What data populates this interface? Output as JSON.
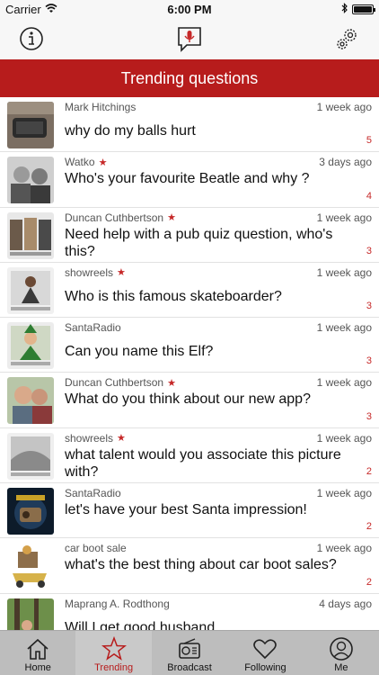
{
  "status_bar": {
    "carrier": "Carrier",
    "time": "6:00 PM",
    "battery_level": 1.0
  },
  "banner": {
    "title": "Trending questions"
  },
  "colors": {
    "brand_red": "#b71c1c",
    "count_red": "#c62828",
    "tab_bar": "#bdbdbd"
  },
  "questions": [
    {
      "author": "Mark Hitchings",
      "starred": false,
      "time": "1 week ago",
      "text": "why do my balls hurt",
      "count": "5"
    },
    {
      "author": "Watko",
      "starred": true,
      "time": "3 days ago",
      "text": "Who's your favourite Beatle and why ?",
      "count": "4"
    },
    {
      "author": "Duncan Cuthbertson",
      "starred": true,
      "time": "1 week ago",
      "text": "Need help with a pub quiz question, who's this?",
      "count": "3"
    },
    {
      "author": "showreels",
      "starred": true,
      "time": "1 week ago",
      "text": "Who is this famous skateboarder?",
      "count": "3"
    },
    {
      "author": "SantaRadio",
      "starred": false,
      "time": "1 week ago",
      "text": "Can you name this Elf?",
      "count": "3"
    },
    {
      "author": "Duncan Cuthbertson",
      "starred": true,
      "time": "1 week ago",
      "text": "What do you think about our new app?",
      "count": "3"
    },
    {
      "author": "showreels",
      "starred": true,
      "time": "1 week ago",
      "text": "what talent would you associate this picture with?",
      "count": "2"
    },
    {
      "author": "SantaRadio",
      "starred": false,
      "time": "1 week ago",
      "text": "let's have your best Santa impression!",
      "count": "2"
    },
    {
      "author": "car boot sale",
      "starred": false,
      "time": "1 week ago",
      "text": "what's the best thing about car boot sales?",
      "count": "2"
    },
    {
      "author": "Maprang A. Rodthong",
      "starred": false,
      "time": "4 days ago",
      "text": "Will I get good husband",
      "count": ""
    }
  ],
  "tabs": [
    {
      "label": "Home",
      "icon": "home-icon"
    },
    {
      "label": "Trending",
      "icon": "star-icon"
    },
    {
      "label": "Broadcast",
      "icon": "radio-icon"
    },
    {
      "label": "Following",
      "icon": "heart-icon"
    },
    {
      "label": "Me",
      "icon": "user-icon"
    }
  ]
}
